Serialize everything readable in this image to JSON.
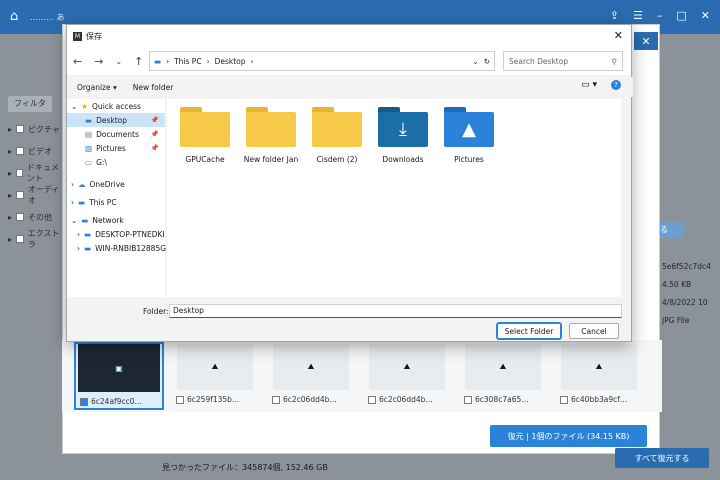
{
  "app": {
    "title": "……… あ",
    "recover_label": "復元 | 1個のファイル (34.15 KB)",
    "recover_all_label": "すべて復元する",
    "status": "見つかったファイル：345874個, 152.46 GB",
    "filter_label": "フィルタ",
    "left_tree": [
      "ピクチャ",
      "ビデオ",
      "ドキュメント",
      "オーディオ",
      "その他",
      "エクストラ"
    ],
    "details": [
      "5e6f52c7dc4",
      "4.50 KB",
      "4/8/2022 10",
      "JPG File"
    ],
    "details_button": "する",
    "thumbnails": [
      "6c24af9cc0…",
      "6c259f135b…",
      "6c2c06dd4b…",
      "6c2c06dd4b…",
      "6c308c7a65…",
      "6c40bb3a9cf…"
    ]
  },
  "dialog": {
    "title": "保存",
    "breadcrumb": [
      "This PC",
      "Desktop"
    ],
    "search_placeholder": "Search Desktop",
    "organize": "Organize",
    "new_folder": "New folder",
    "nav": {
      "quick_access": "Quick access",
      "quick_items": [
        "Desktop",
        "Documents",
        "Pictures",
        "G:\\"
      ],
      "onedrive": "OneDrive",
      "this_pc": "This PC",
      "network": "Network",
      "network_items": [
        "DESKTOP-PTNEDKI",
        "WIN-RNBIB12885G"
      ]
    },
    "folders": [
      {
        "name": "GPUCache",
        "color": "#f7c948"
      },
      {
        "name": "New folder Jan",
        "color": "#f7c948"
      },
      {
        "name": "Cisdem (2)",
        "color": "#f7c948"
      },
      {
        "name": "Downloads",
        "color": "#1b6ea8"
      },
      {
        "name": "Pictures",
        "color": "#2b82d9"
      }
    ],
    "folder_label": "Folder:",
    "folder_value": "Desktop",
    "select_button": "Select Folder",
    "cancel_button": "Cancel"
  }
}
